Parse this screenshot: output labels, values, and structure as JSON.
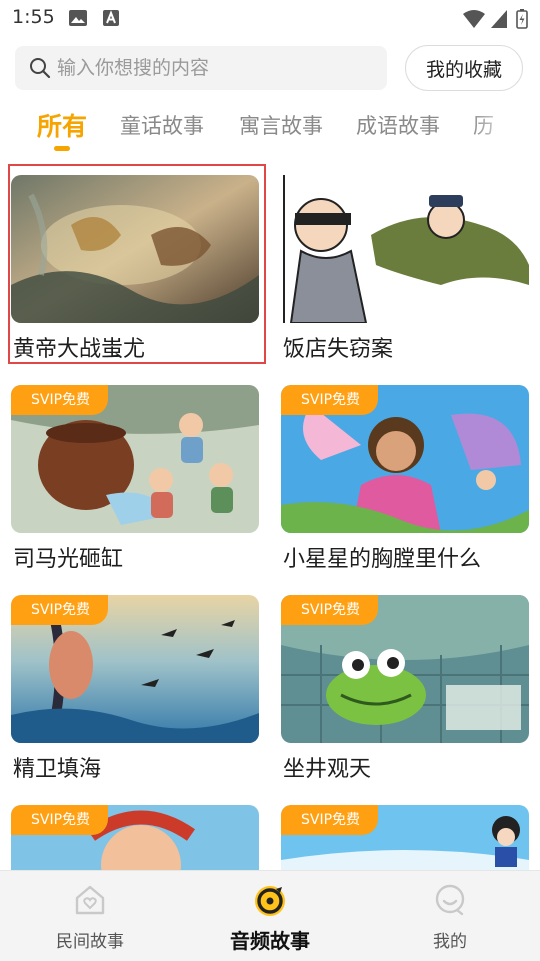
{
  "status_bar": {
    "time": "1:55"
  },
  "search": {
    "placeholder": "输入你想搜的内容"
  },
  "favorites_button": "我的收藏",
  "tabs": [
    {
      "label": "所有",
      "active": true
    },
    {
      "label": "童话故事"
    },
    {
      "label": "寓言故事"
    },
    {
      "label": "成语故事"
    },
    {
      "label": "历"
    }
  ],
  "badge_text": "SVIP免费",
  "stories": [
    {
      "title": "黄帝大战蚩尤",
      "badge": false,
      "icon": "battle-illustration"
    },
    {
      "title": "饭店失窃案",
      "badge": false,
      "icon": "thief-illustration"
    },
    {
      "title": "司马光砸缸",
      "badge": true,
      "icon": "vat-illustration"
    },
    {
      "title": "小星星的胸膛里什么",
      "badge": true,
      "icon": "fairy-girl-illustration"
    },
    {
      "title": "精卫填海",
      "badge": true,
      "icon": "sea-bird-illustration"
    },
    {
      "title": "坐井观天",
      "badge": true,
      "icon": "frog-well-illustration"
    },
    {
      "title": "",
      "badge": true,
      "icon": "old-man-illustration"
    },
    {
      "title": "",
      "badge": true,
      "icon": "snow-white-illustration"
    }
  ],
  "bottom_nav": [
    {
      "label": "民间故事",
      "icon": "house-heart-icon"
    },
    {
      "label": "音频故事",
      "icon": "audio-disc-icon",
      "active": true
    },
    {
      "label": "我的",
      "icon": "profile-icon"
    }
  ],
  "colors": {
    "accent": "#f5a400",
    "badge": "#ffa012",
    "selection": "#e04848"
  }
}
